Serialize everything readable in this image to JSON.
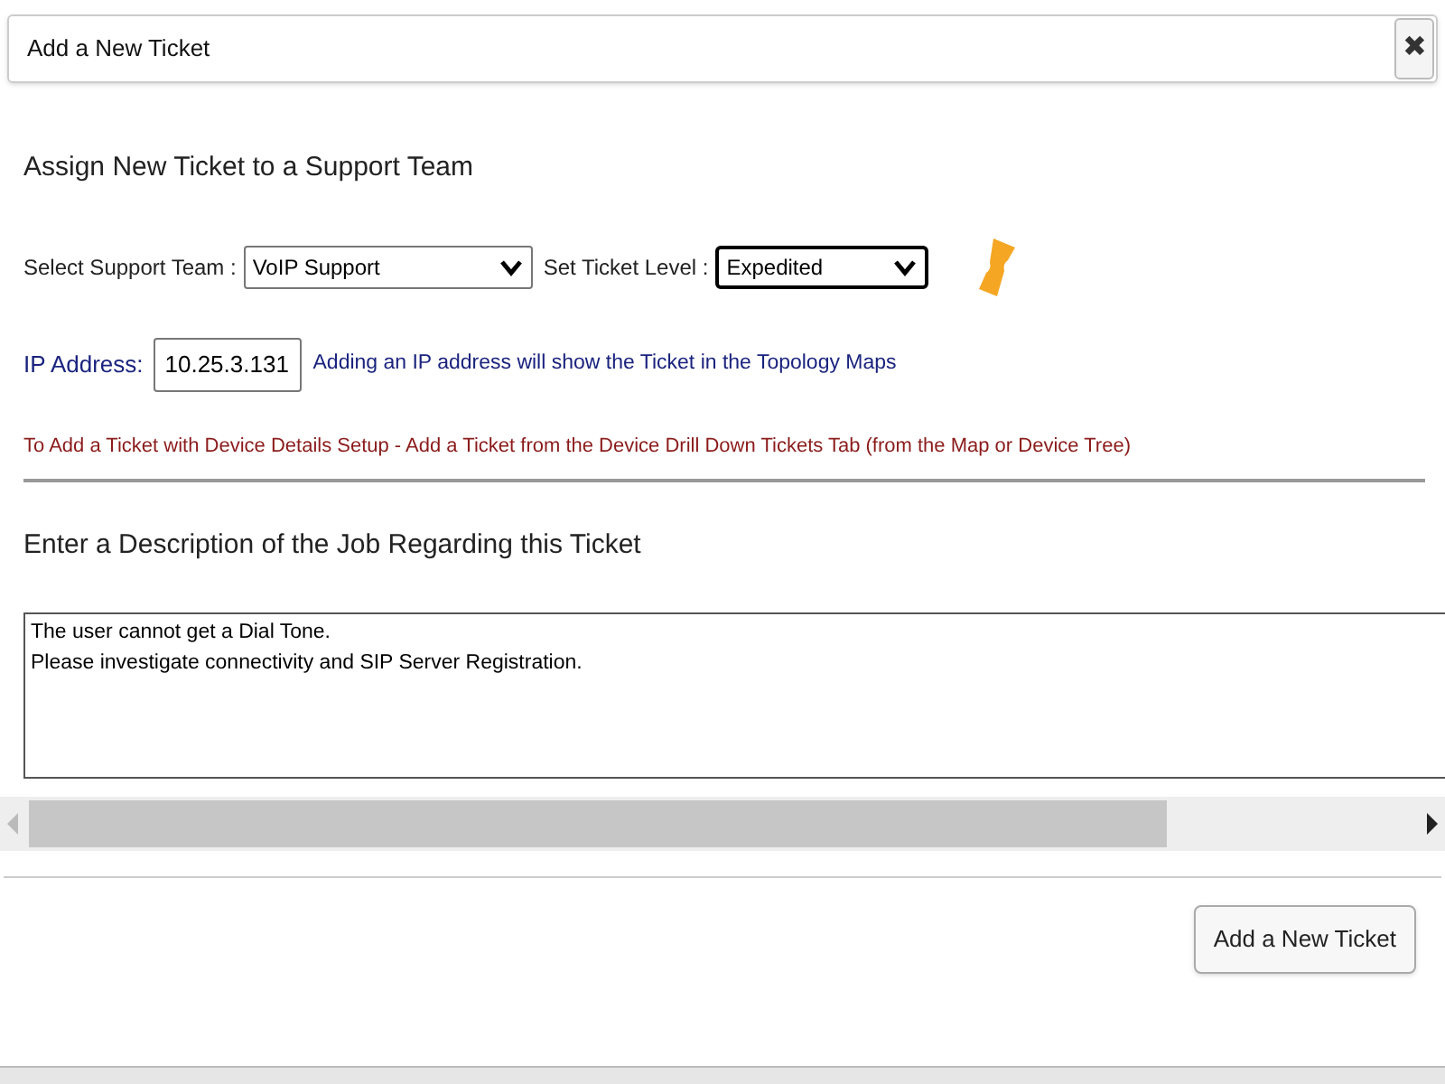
{
  "dialog": {
    "title": "Add a New Ticket",
    "close_label": "✖"
  },
  "section_title": "Assign New Ticket to a Support Team",
  "team_select": {
    "label": "Select Support Team :",
    "value": "VoIP Support"
  },
  "level_select": {
    "label": "Set Ticket Level :",
    "value": "Expedited",
    "focused": true
  },
  "ip": {
    "label": "IP Address:",
    "value": "10.25.3.131",
    "hint": "Adding an IP address will show the Ticket in the Topology Maps"
  },
  "notice": "To Add a Ticket with Device Details Setup - Add a Ticket from the Device Drill Down Tickets Tab (from the Map or Device Tree)",
  "description_title": "Enter a Description of the Job Regarding this Ticket",
  "description": {
    "value": "The user cannot get a Dial Tone.\nPlease investigate connectivity and SIP Server Registration."
  },
  "submit_button": "Add a New Ticket"
}
